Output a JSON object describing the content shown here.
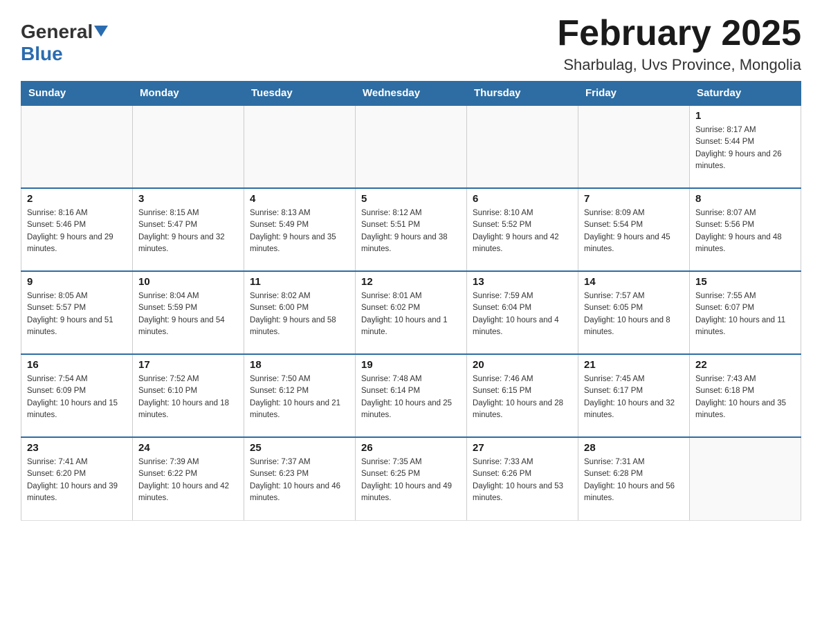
{
  "logo": {
    "general": "General",
    "blue": "Blue"
  },
  "header": {
    "month": "February 2025",
    "location": "Sharbulag, Uvs Province, Mongolia"
  },
  "weekdays": [
    "Sunday",
    "Monday",
    "Tuesday",
    "Wednesday",
    "Thursday",
    "Friday",
    "Saturday"
  ],
  "weeks": [
    [
      {
        "day": "",
        "info": ""
      },
      {
        "day": "",
        "info": ""
      },
      {
        "day": "",
        "info": ""
      },
      {
        "day": "",
        "info": ""
      },
      {
        "day": "",
        "info": ""
      },
      {
        "day": "",
        "info": ""
      },
      {
        "day": "1",
        "info": "Sunrise: 8:17 AM\nSunset: 5:44 PM\nDaylight: 9 hours and 26 minutes."
      }
    ],
    [
      {
        "day": "2",
        "info": "Sunrise: 8:16 AM\nSunset: 5:46 PM\nDaylight: 9 hours and 29 minutes."
      },
      {
        "day": "3",
        "info": "Sunrise: 8:15 AM\nSunset: 5:47 PM\nDaylight: 9 hours and 32 minutes."
      },
      {
        "day": "4",
        "info": "Sunrise: 8:13 AM\nSunset: 5:49 PM\nDaylight: 9 hours and 35 minutes."
      },
      {
        "day": "5",
        "info": "Sunrise: 8:12 AM\nSunset: 5:51 PM\nDaylight: 9 hours and 38 minutes."
      },
      {
        "day": "6",
        "info": "Sunrise: 8:10 AM\nSunset: 5:52 PM\nDaylight: 9 hours and 42 minutes."
      },
      {
        "day": "7",
        "info": "Sunrise: 8:09 AM\nSunset: 5:54 PM\nDaylight: 9 hours and 45 minutes."
      },
      {
        "day": "8",
        "info": "Sunrise: 8:07 AM\nSunset: 5:56 PM\nDaylight: 9 hours and 48 minutes."
      }
    ],
    [
      {
        "day": "9",
        "info": "Sunrise: 8:05 AM\nSunset: 5:57 PM\nDaylight: 9 hours and 51 minutes."
      },
      {
        "day": "10",
        "info": "Sunrise: 8:04 AM\nSunset: 5:59 PM\nDaylight: 9 hours and 54 minutes."
      },
      {
        "day": "11",
        "info": "Sunrise: 8:02 AM\nSunset: 6:00 PM\nDaylight: 9 hours and 58 minutes."
      },
      {
        "day": "12",
        "info": "Sunrise: 8:01 AM\nSunset: 6:02 PM\nDaylight: 10 hours and 1 minute."
      },
      {
        "day": "13",
        "info": "Sunrise: 7:59 AM\nSunset: 6:04 PM\nDaylight: 10 hours and 4 minutes."
      },
      {
        "day": "14",
        "info": "Sunrise: 7:57 AM\nSunset: 6:05 PM\nDaylight: 10 hours and 8 minutes."
      },
      {
        "day": "15",
        "info": "Sunrise: 7:55 AM\nSunset: 6:07 PM\nDaylight: 10 hours and 11 minutes."
      }
    ],
    [
      {
        "day": "16",
        "info": "Sunrise: 7:54 AM\nSunset: 6:09 PM\nDaylight: 10 hours and 15 minutes."
      },
      {
        "day": "17",
        "info": "Sunrise: 7:52 AM\nSunset: 6:10 PM\nDaylight: 10 hours and 18 minutes."
      },
      {
        "day": "18",
        "info": "Sunrise: 7:50 AM\nSunset: 6:12 PM\nDaylight: 10 hours and 21 minutes."
      },
      {
        "day": "19",
        "info": "Sunrise: 7:48 AM\nSunset: 6:14 PM\nDaylight: 10 hours and 25 minutes."
      },
      {
        "day": "20",
        "info": "Sunrise: 7:46 AM\nSunset: 6:15 PM\nDaylight: 10 hours and 28 minutes."
      },
      {
        "day": "21",
        "info": "Sunrise: 7:45 AM\nSunset: 6:17 PM\nDaylight: 10 hours and 32 minutes."
      },
      {
        "day": "22",
        "info": "Sunrise: 7:43 AM\nSunset: 6:18 PM\nDaylight: 10 hours and 35 minutes."
      }
    ],
    [
      {
        "day": "23",
        "info": "Sunrise: 7:41 AM\nSunset: 6:20 PM\nDaylight: 10 hours and 39 minutes."
      },
      {
        "day": "24",
        "info": "Sunrise: 7:39 AM\nSunset: 6:22 PM\nDaylight: 10 hours and 42 minutes."
      },
      {
        "day": "25",
        "info": "Sunrise: 7:37 AM\nSunset: 6:23 PM\nDaylight: 10 hours and 46 minutes."
      },
      {
        "day": "26",
        "info": "Sunrise: 7:35 AM\nSunset: 6:25 PM\nDaylight: 10 hours and 49 minutes."
      },
      {
        "day": "27",
        "info": "Sunrise: 7:33 AM\nSunset: 6:26 PM\nDaylight: 10 hours and 53 minutes."
      },
      {
        "day": "28",
        "info": "Sunrise: 7:31 AM\nSunset: 6:28 PM\nDaylight: 10 hours and 56 minutes."
      },
      {
        "day": "",
        "info": ""
      }
    ]
  ]
}
